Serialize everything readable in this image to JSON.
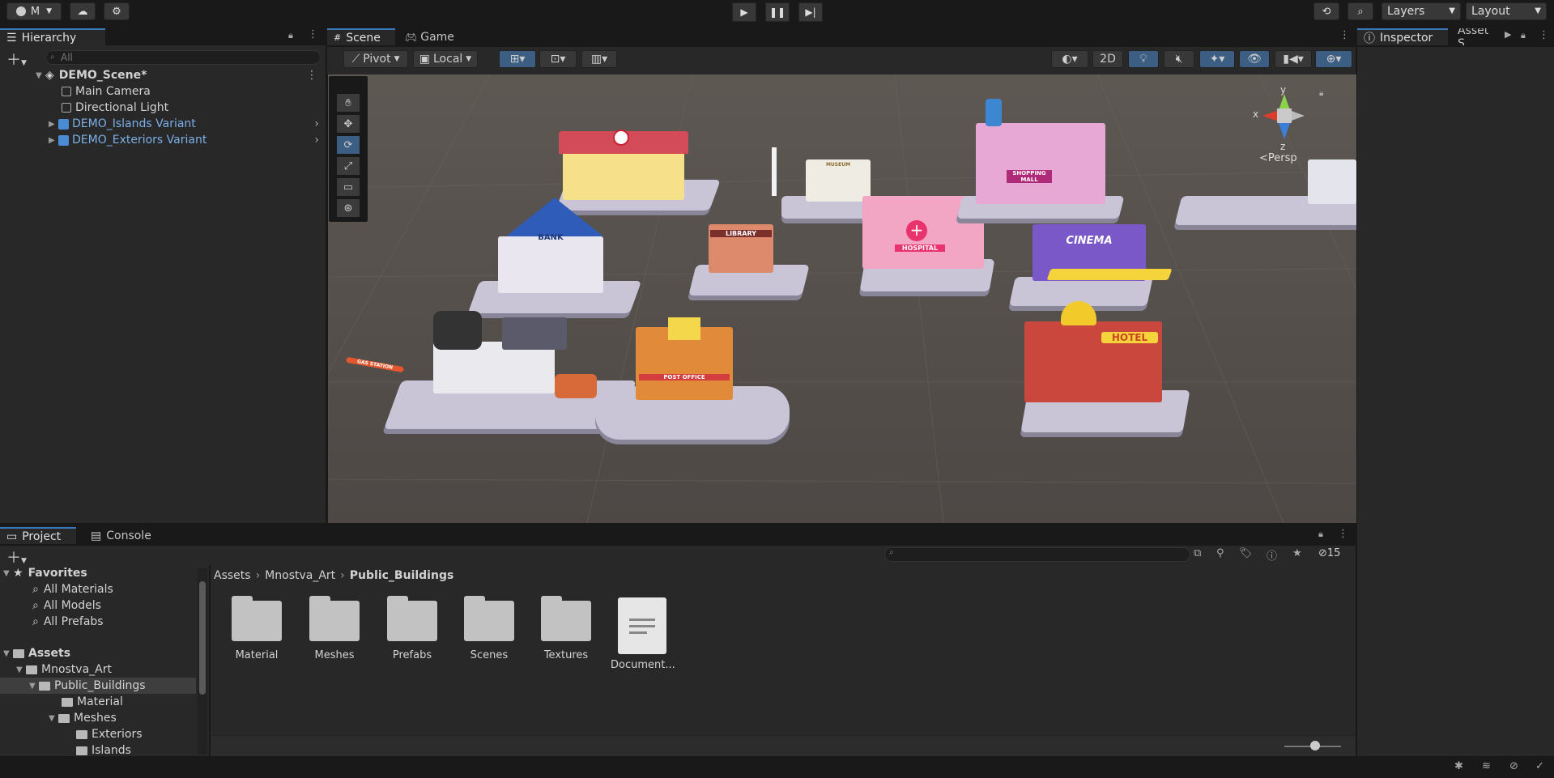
{
  "toolbar": {
    "account": "M",
    "layers": "Layers",
    "layout": "Layout"
  },
  "hierarchy": {
    "tab": "Hierarchy",
    "search_placeholder": "All",
    "scene": "DEMO_Scene*",
    "items": [
      "Main Camera",
      "Directional Light",
      "DEMO_Islands Variant",
      "DEMO_Exteriors Variant"
    ]
  },
  "scene_view": {
    "tab_scene": "Scene",
    "tab_game": "Game",
    "pivot": "Pivot",
    "local": "Local",
    "btn_2d": "2D",
    "persp": "Persp",
    "axes": {
      "x": "x",
      "y": "y",
      "z": "z"
    },
    "signs": [
      "BANK",
      "LIBRARY",
      "MUSEUM",
      "HOSPITAL",
      "SHOPPING MALL",
      "CINEMA",
      "HOTEL",
      "POST OFFICE",
      "GAS STATION"
    ]
  },
  "inspector": {
    "tab": "Inspector",
    "tab2": "Asset S"
  },
  "project": {
    "tab": "Project",
    "console_tab": "Console",
    "hidden_count": "15",
    "favorites": {
      "label": "Favorites",
      "items": [
        "All Materials",
        "All Models",
        "All Prefabs"
      ]
    },
    "tree": {
      "assets": "Assets",
      "mnostva": "Mnostva_Art",
      "public": "Public_Buildings",
      "material": "Material",
      "meshes": "Meshes",
      "exteriors": "Exteriors",
      "islands": "Islands"
    },
    "breadcrumb": [
      "Assets",
      "Mnostva_Art",
      "Public_Buildings"
    ],
    "assets": [
      "Material",
      "Meshes",
      "Prefabs",
      "Scenes",
      "Textures",
      "Document..."
    ]
  },
  "colors": {
    "accent": "#3a79bb",
    "prefab_text": "#7bafe8",
    "panel_bg": "#282828",
    "toolbar_bg": "#191919"
  }
}
